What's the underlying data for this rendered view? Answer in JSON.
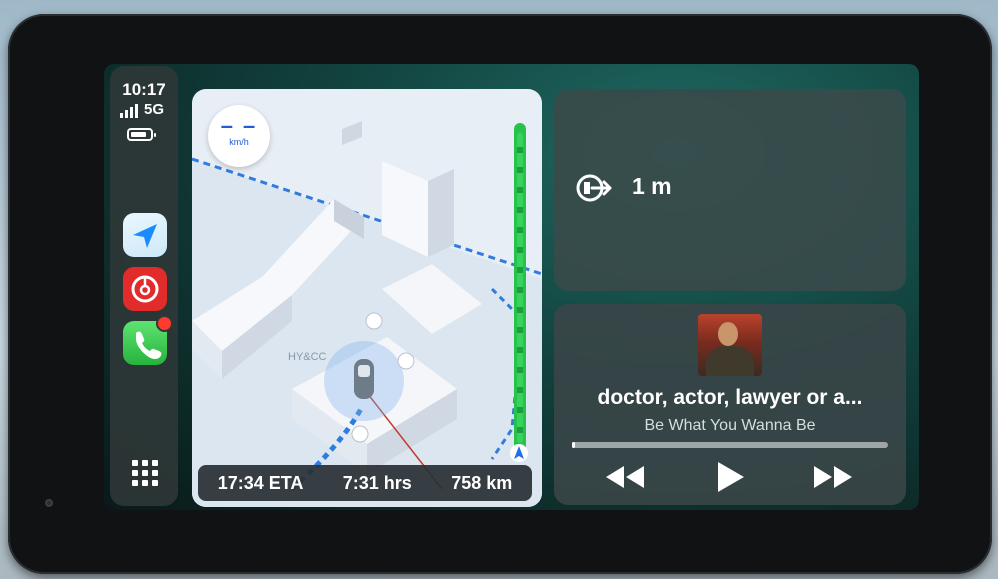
{
  "status": {
    "time": "10:17",
    "network": "5G"
  },
  "sidebar": {
    "apps": [
      {
        "name": "maps-app-icon"
      },
      {
        "name": "music-app-icon"
      },
      {
        "name": "phone-app-icon",
        "has_badge": true
      }
    ]
  },
  "map": {
    "speed_value": "– –",
    "speed_unit": "km/h",
    "place_label": "HY&CC",
    "eta": "17:34 ETA",
    "duration": "7:31 hrs",
    "distance": "758 km"
  },
  "navigation": {
    "maneuver_icon": "exit-turn-right-icon",
    "distance": "1 m"
  },
  "now_playing": {
    "song_title": "doctor, actor, lawyer or a...",
    "album": "Be What You Wanna Be",
    "progress_fraction": 0.01
  },
  "colors": {
    "accent_blue": "#1f5ed6",
    "traffic_green": "#27c24c",
    "music_red": "#e22b2b",
    "phone_green": "#34c759",
    "badge_red": "#ff3b30"
  }
}
